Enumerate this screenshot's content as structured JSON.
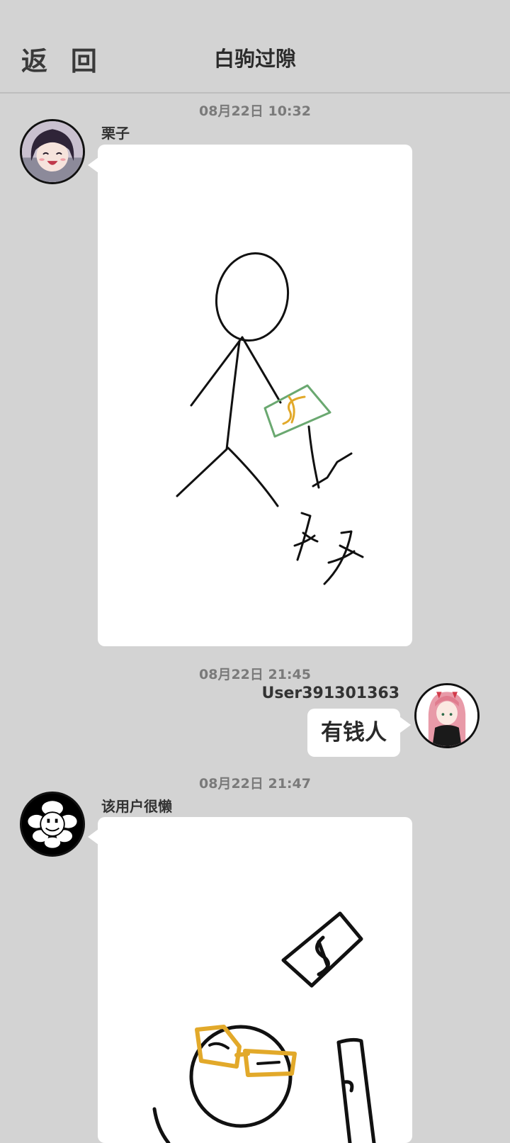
{
  "header": {
    "back_label": "返 回",
    "title": "白驹过隙"
  },
  "messages": [
    {
      "timestamp": "08月22日  10:32",
      "sender": "栗子",
      "type": "drawing",
      "avatar_icon": "anime-girl-dark-hair-avatar",
      "drawing_text": "夕夕"
    },
    {
      "timestamp": "08月22日  21:45",
      "sender": "User391301363",
      "type": "text",
      "text": "有钱人",
      "avatar_icon": "anime-girl-pink-hair-avatar"
    },
    {
      "timestamp": "08月22日  21:47",
      "sender": "该用户很懒",
      "type": "drawing",
      "avatar_icon": "flower-face-avatar"
    }
  ],
  "colors": {
    "background": "#d3d3d3",
    "bubble": "#ffffff",
    "money_green": "#6aa870",
    "money_gold": "#e2a92a"
  }
}
